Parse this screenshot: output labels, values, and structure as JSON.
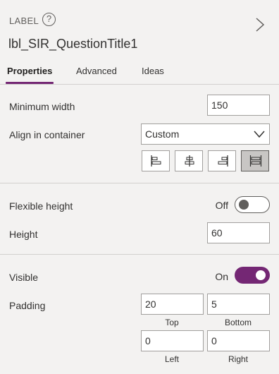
{
  "header": {
    "control_type": "LABEL",
    "help_icon_glyph": "?",
    "control_name": "lbl_SIR_QuestionTitle1"
  },
  "tabs": [
    {
      "label": "Properties",
      "active": true
    },
    {
      "label": "Advanced",
      "active": false
    },
    {
      "label": "Ideas",
      "active": false
    }
  ],
  "properties": {
    "min_width": {
      "label": "Minimum width",
      "value": "150"
    },
    "align_in_container": {
      "label": "Align in container",
      "value": "Custom",
      "options_icons": [
        "align-start-icon",
        "align-center-icon",
        "align-end-icon",
        "align-stretch-icon"
      ],
      "selected_index": 3
    },
    "flexible_height": {
      "label": "Flexible height",
      "state_label": "Off",
      "on": false
    },
    "height": {
      "label": "Height",
      "value": "60"
    },
    "visible": {
      "label": "Visible",
      "state_label": "On",
      "on": true
    },
    "padding": {
      "label": "Padding",
      "top": {
        "value": "20",
        "caption": "Top"
      },
      "bottom": {
        "value": "5",
        "caption": "Bottom"
      },
      "left": {
        "value": "0",
        "caption": "Left"
      },
      "right": {
        "value": "0",
        "caption": "Right"
      }
    }
  },
  "colors": {
    "accent": "#742774",
    "background": "#f3f2f1",
    "border": "#a19f9d"
  }
}
